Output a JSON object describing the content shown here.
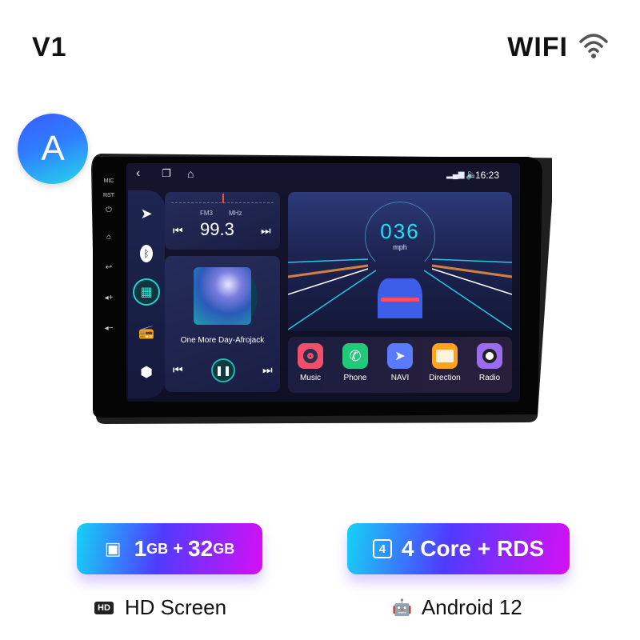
{
  "header": {
    "model": "V1",
    "wifi_label": "WIFI",
    "wifi_icon": "wifi-icon"
  },
  "variant_badge": "A",
  "side_buttons": [
    "MIC",
    "RST",
    "power",
    "home",
    "back",
    "vol+",
    "vol-"
  ],
  "statusbar": {
    "time": "16:23",
    "signal": "4G",
    "nav": [
      "back",
      "recent",
      "home"
    ]
  },
  "dock": {
    "items": [
      "navigation",
      "bluetooth",
      "apps",
      "radio",
      "settings"
    ],
    "active": "apps"
  },
  "radio": {
    "band": "FM3",
    "unit": "MHz",
    "frequency": "99.3"
  },
  "music": {
    "title": "One More Day-Afrojack",
    "state": "playing"
  },
  "speedometer": {
    "speed": "036",
    "unit": "mph"
  },
  "apps": [
    {
      "label": "Music",
      "color": "#ef4f6b"
    },
    {
      "label": "Phone",
      "color": "#23c97a"
    },
    {
      "label": "NAVI",
      "color": "#5b7bff"
    },
    {
      "label": "Direction",
      "color": "#ffa21c"
    },
    {
      "label": "Radio",
      "color": "#9b6cf0"
    }
  ],
  "specs": {
    "memory": {
      "ram": "1",
      "ram_unit": "GB",
      "plus": "+",
      "rom": "32",
      "rom_unit": "GB"
    },
    "core": {
      "chip_num": "4",
      "label": "4 Core + RDS"
    },
    "screen": {
      "badge": "HD",
      "label": "HD Screen"
    },
    "os": {
      "label": "Android 12"
    }
  }
}
